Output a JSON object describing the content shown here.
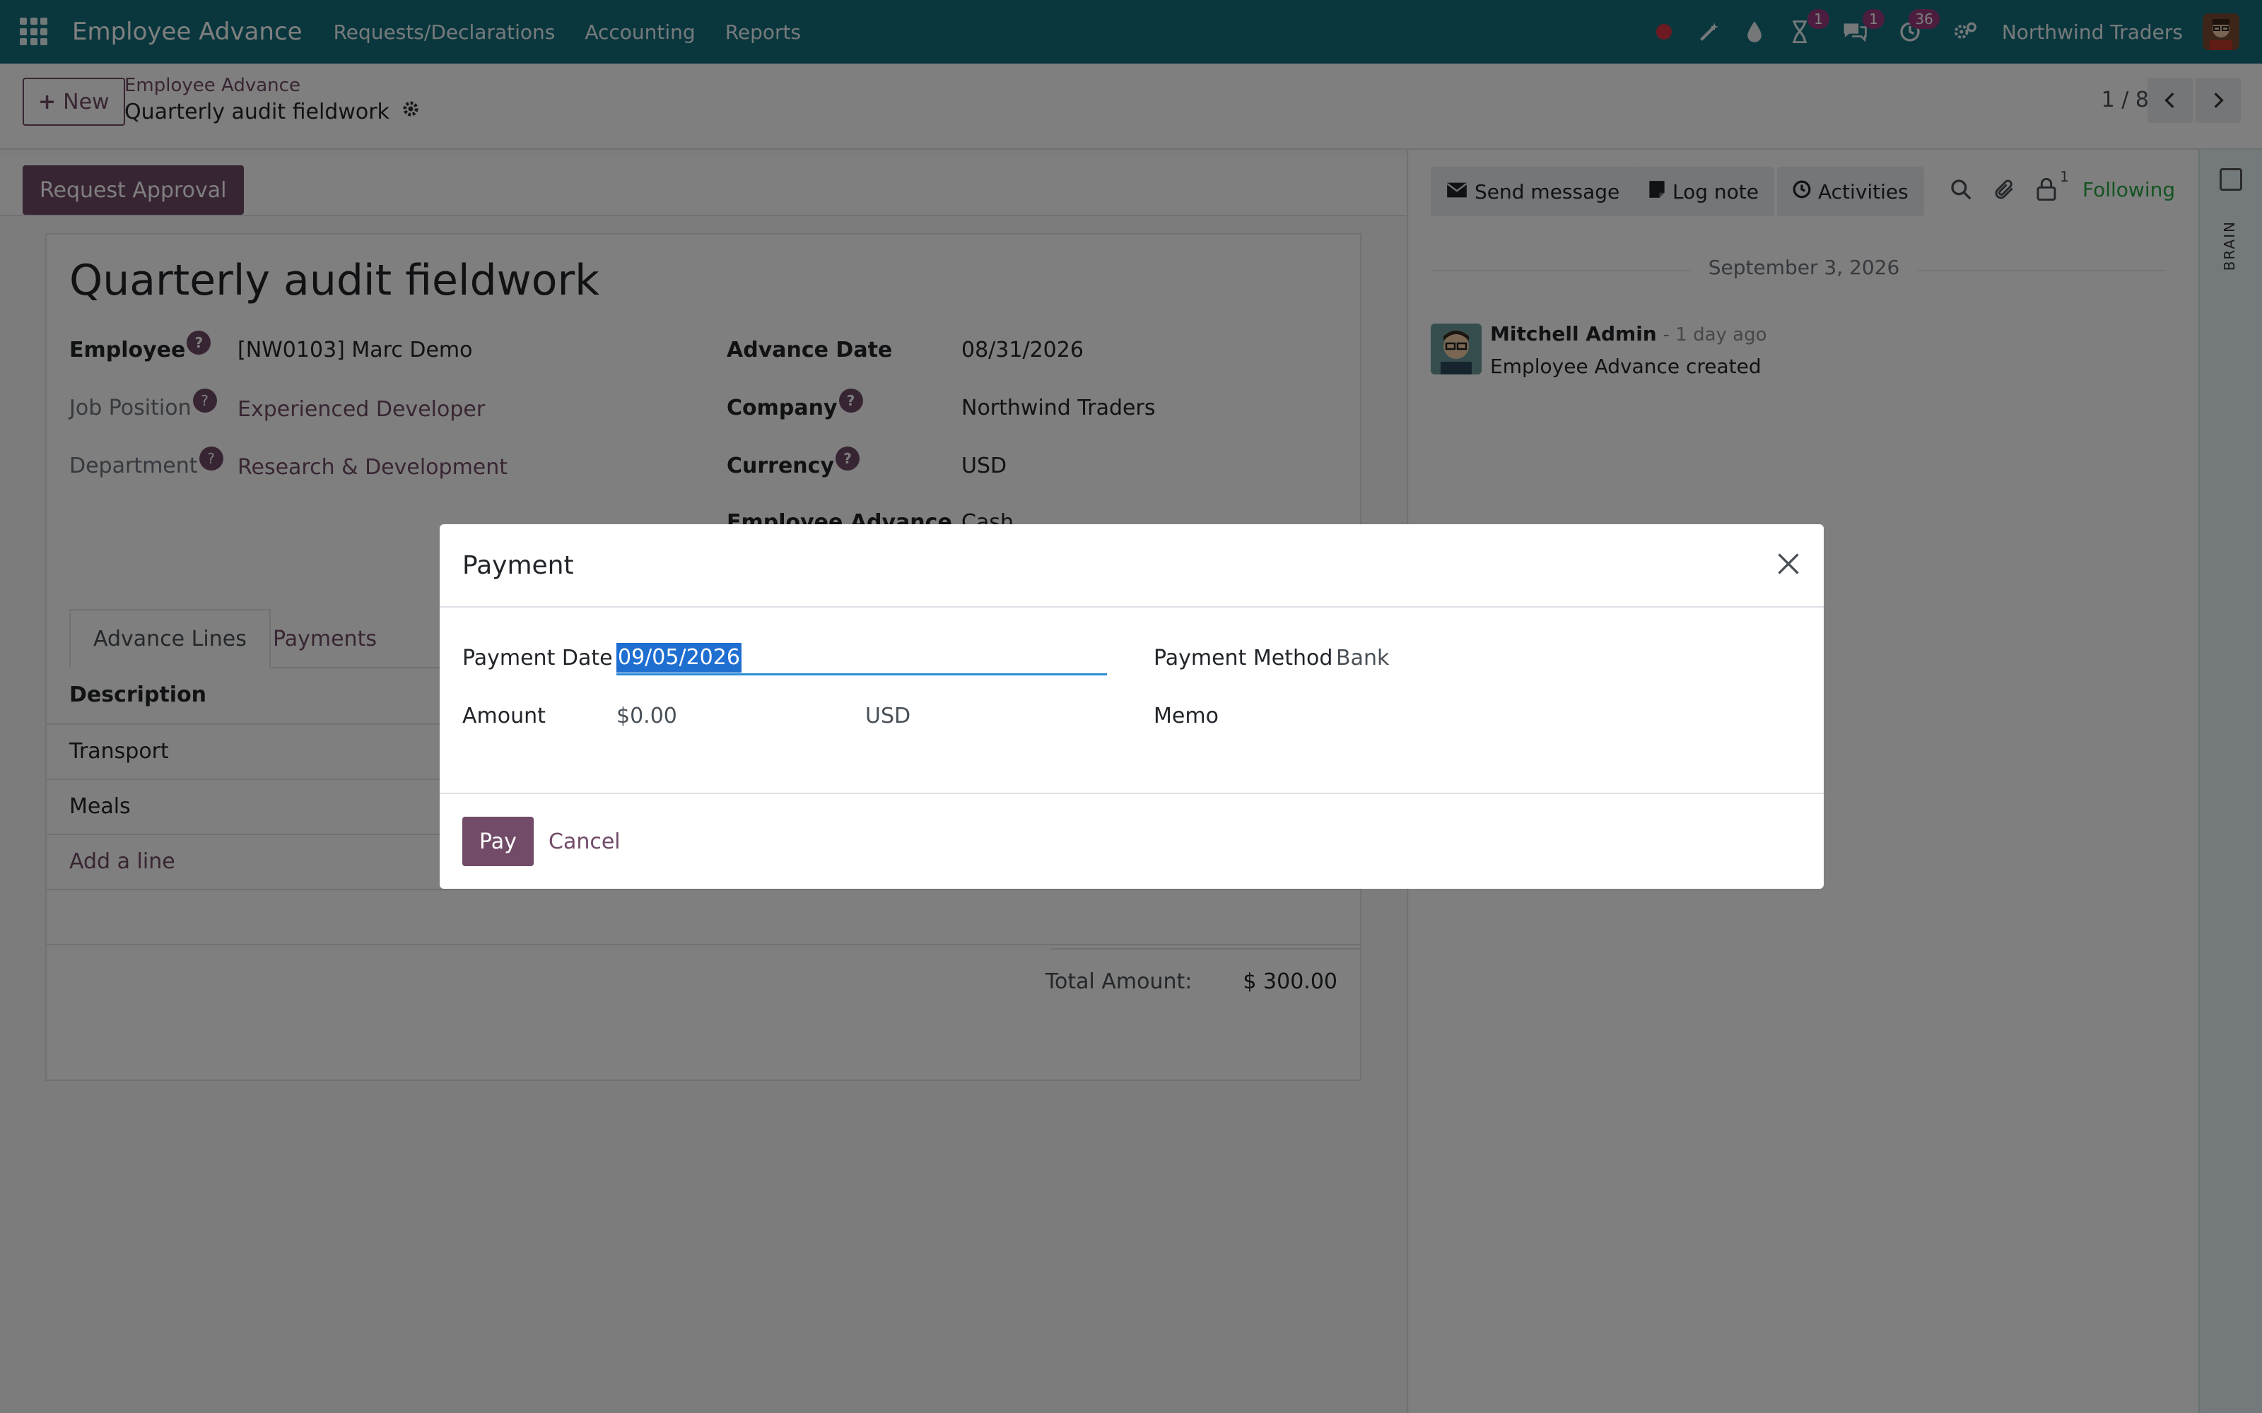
{
  "navbar": {
    "brand": "Employee Advance",
    "menu": [
      "Requests/Declarations",
      "Accounting",
      "Reports"
    ],
    "badges": {
      "activities": "1",
      "messages": "1",
      "timer": "36"
    },
    "company": "Northwind Traders"
  },
  "control_panel": {
    "new_label": "New",
    "breadcrumb_parent": "Employee Advance",
    "breadcrumb_current": "Quarterly audit fieldwork",
    "pager": "1 / 8"
  },
  "statusbar": {
    "request_approval": "Request Approval"
  },
  "form": {
    "title": "Quarterly audit fieldwork",
    "fields": {
      "employee_label": "Employee",
      "employee_value": "[NW0103] Marc Demo",
      "job_label": "Job Position",
      "job_value": "Experienced Developer",
      "department_label": "Department",
      "department_value": "Research & Development",
      "advance_date_label": "Advance Date",
      "advance_date_value": "08/31/2026",
      "company_label": "Company",
      "company_value": "Northwind Traders",
      "currency_label": "Currency",
      "currency_value": "USD",
      "emp_advance_label": "Employee Advance",
      "emp_advance_value": "Cash"
    },
    "tabs": [
      "Advance Lines",
      "Payments"
    ],
    "lines_header": "Description",
    "lines": [
      "Transport",
      "Meals"
    ],
    "add_line": "Add a line",
    "total_label": "Total Amount:",
    "total_value": "$ 300.00"
  },
  "chatter": {
    "send_message": "Send message",
    "log_note": "Log note",
    "activities": "Activities",
    "followers_count": "1",
    "following": "Following",
    "date_separator": "September 3, 2026",
    "message": {
      "author": "Mitchell Admin",
      "ago": "- 1 day ago",
      "body": "Employee Advance created"
    }
  },
  "side_strip": {
    "label": "BRAIN"
  },
  "modal": {
    "title": "Payment",
    "payment_date_label": "Payment Date",
    "payment_date_value": "09/05/2026",
    "amount_label": "Amount",
    "amount_value": "$0.00",
    "amount_currency": "USD",
    "payment_method_label": "Payment Method",
    "payment_method_value": "Bank",
    "memo_label": "Memo",
    "pay_label": "Pay",
    "cancel_label": "Cancel"
  },
  "colors": {
    "navbar": "#146f7c",
    "primary": "#714b67",
    "following": "#28a745",
    "selection": "#1f6fd1"
  }
}
